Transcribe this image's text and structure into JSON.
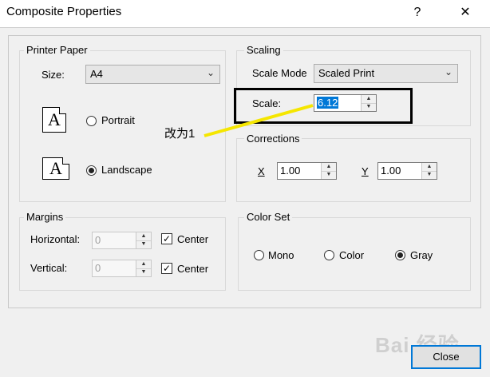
{
  "window": {
    "title": "Composite Properties",
    "help_label": "?",
    "close_label": "✕"
  },
  "printer_paper": {
    "group_label": "Printer Paper",
    "size_label": "Size:",
    "size_value": "A4",
    "orientation_icon_letter": "A",
    "portrait_label": "Portrait",
    "landscape_label": "Landscape",
    "selected": "landscape"
  },
  "scaling": {
    "group_label": "Scaling",
    "mode_label": "Scale Mode",
    "mode_value": "Scaled Print",
    "scale_label": "Scale:",
    "scale_value": "6.12"
  },
  "corrections": {
    "group_label": "Corrections",
    "x_label": "X",
    "x_value": "1.00",
    "y_label": "Y",
    "y_value": "1.00"
  },
  "margins": {
    "group_label": "Margins",
    "horizontal_label": "Horizontal:",
    "horizontal_value": "0",
    "horizontal_center_label": "Center",
    "vertical_label": "Vertical:",
    "vertical_value": "0",
    "vertical_center_label": "Center"
  },
  "color_set": {
    "group_label": "Color Set",
    "mono_label": "Mono",
    "color_label": "Color",
    "gray_label": "Gray",
    "selected": "gray"
  },
  "footer": {
    "close_button_label": "Close"
  },
  "annotation": {
    "text": "改为1",
    "line_color": "#f5e600"
  },
  "watermark": {
    "text": "Bai 经验"
  },
  "colors": {
    "accent": "#0078d7",
    "dialog_bg": "#f0f0f0"
  }
}
